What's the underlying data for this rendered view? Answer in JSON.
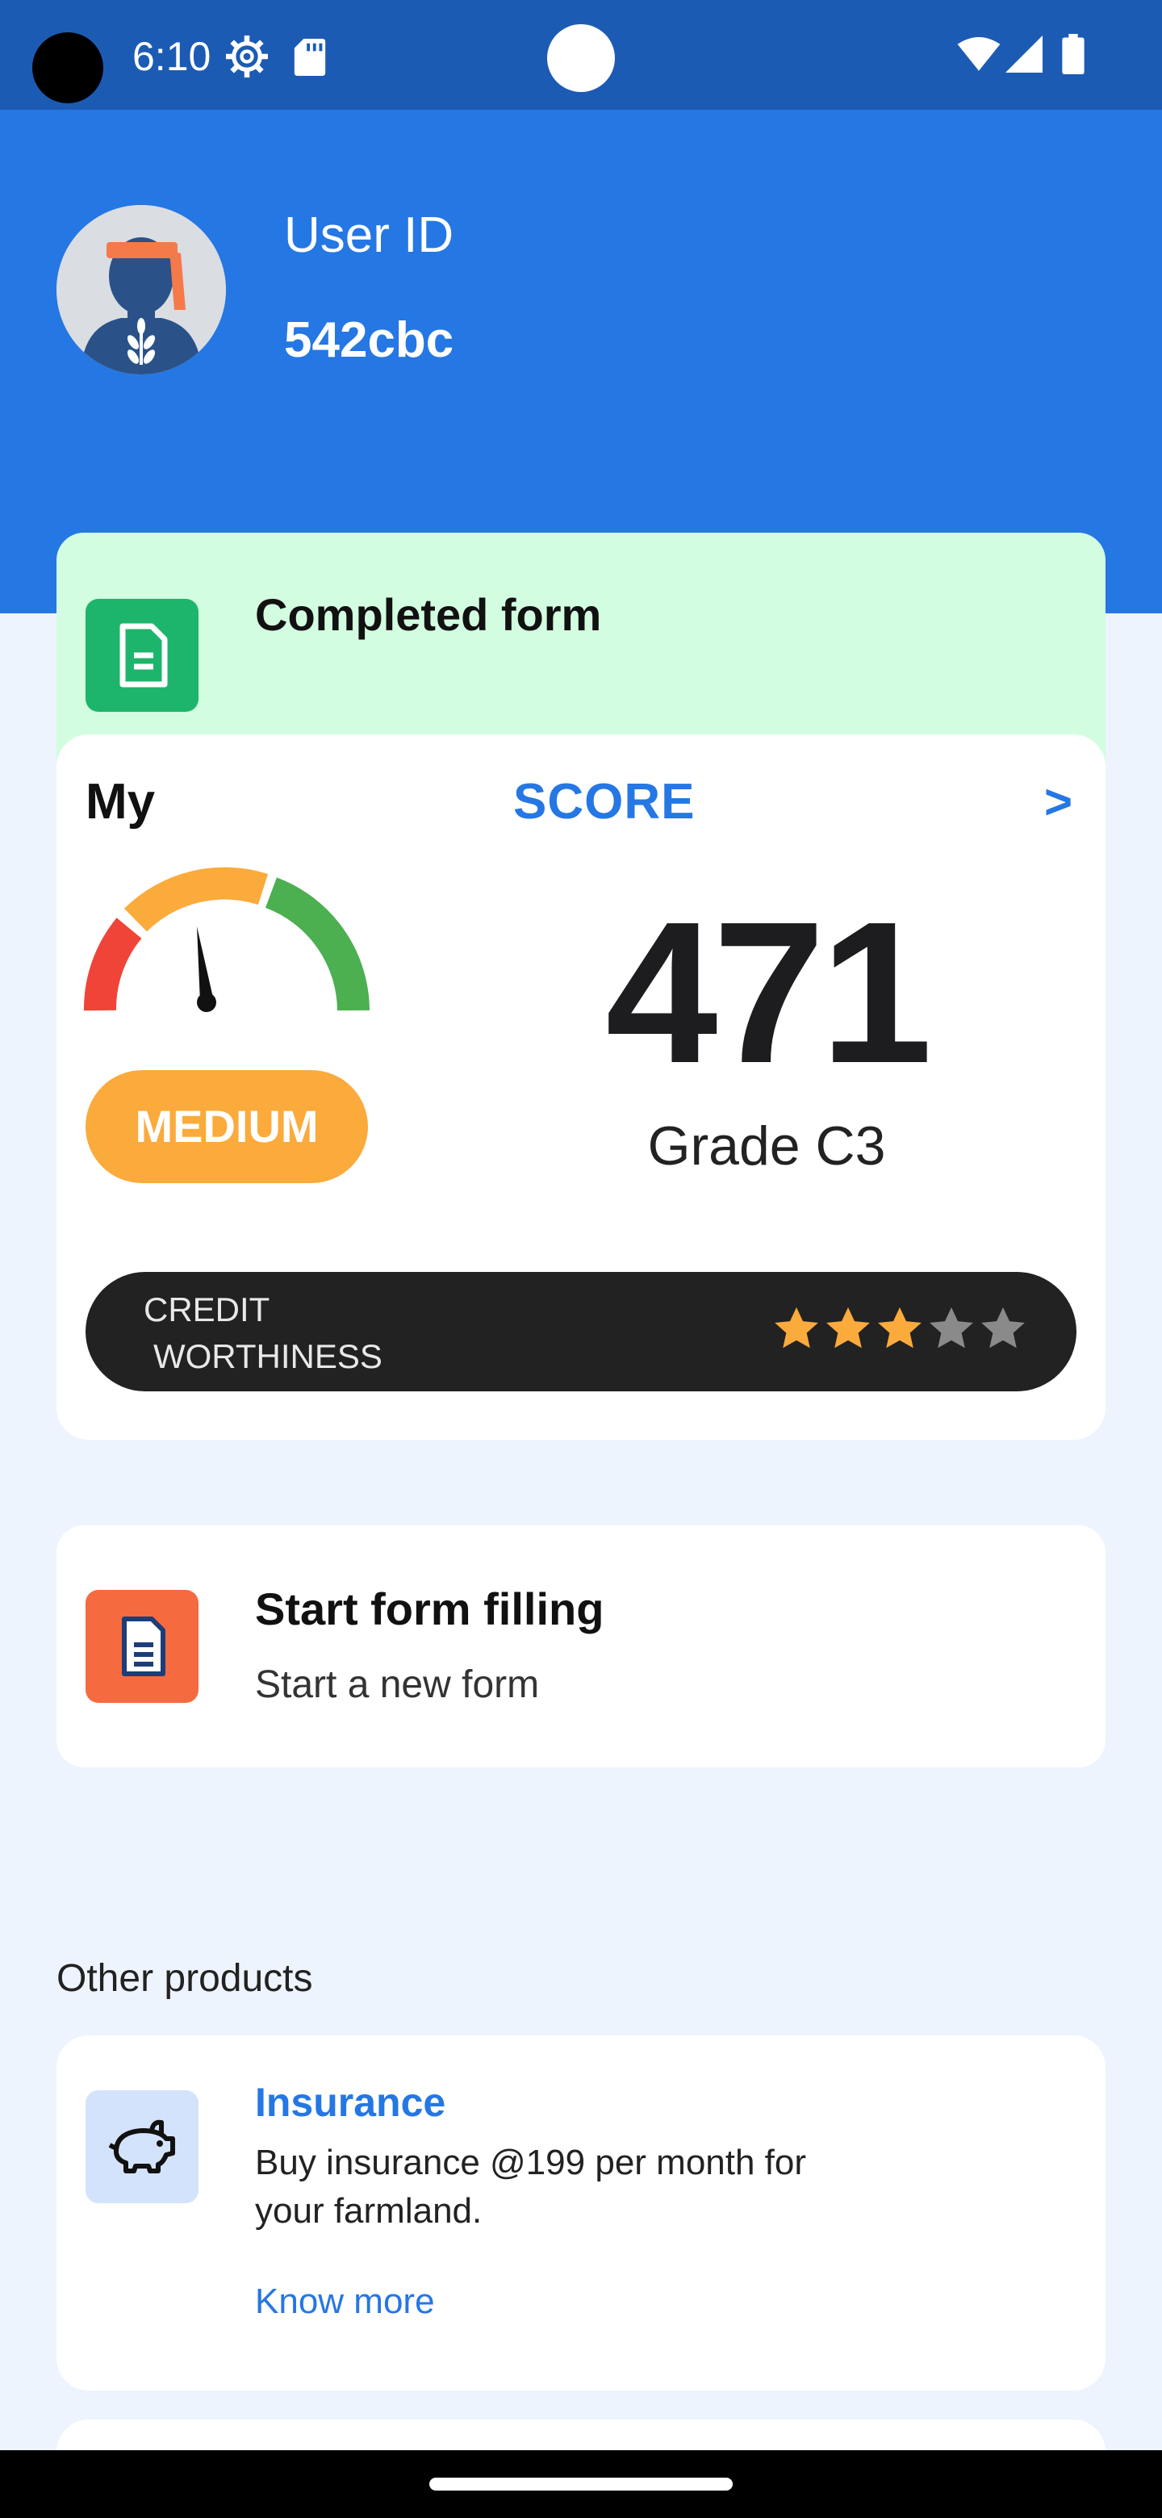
{
  "status_bar": {
    "time": "6:10",
    "icons": [
      "settings-icon",
      "sd-card-icon",
      "wifi-icon",
      "signal-icon",
      "battery-icon"
    ]
  },
  "profile": {
    "label": "User ID",
    "user_id": "542cbc",
    "avatar_icon": "farmer-avatar-icon"
  },
  "completed_form": {
    "title": "Completed form",
    "icon": "document-icon",
    "icon_color": "#1db56b",
    "background": "#d3fde0"
  },
  "score": {
    "prefix": "My",
    "title": "SCORE",
    "arrow": ">",
    "value": "471",
    "grade": "Grade C3",
    "level": "MEDIUM",
    "level_color": "#fbaa3c",
    "credit_label_line1": "CREDIT",
    "credit_label_line2": "WORTHINESS",
    "credit_rating": 3,
    "credit_rating_max": 5
  },
  "start_form": {
    "title": "Start form filling",
    "subtitle": "Start a new form",
    "icon": "document-icon",
    "icon_color": "#f66a40"
  },
  "other_products": {
    "heading": "Other products",
    "items": [
      {
        "title": "Insurance",
        "description": "Buy insurance @199 per month for your farmland.",
        "link": "Know more",
        "icon": "piggy-bank-icon"
      }
    ]
  },
  "colors": {
    "header_blue": "#2577e3",
    "status_bar": "#1c5bb3",
    "page_background": "#eef4fd"
  }
}
